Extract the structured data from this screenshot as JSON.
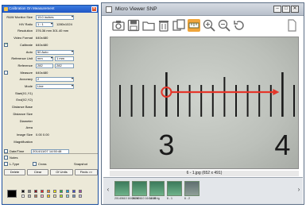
{
  "calibration": {
    "title": "Calibration On Measurement",
    "rows": [
      {
        "label": "R&W Monitor Size",
        "box": "19.0 inches",
        "dd": true
      },
      {
        "label": "H/V Ratio",
        "box": "1 : 1",
        "dd": true,
        "val2": "1280x1024"
      },
      {
        "label": "Resolution",
        "value": "376.36 mm  301.40 mm"
      },
      {
        "label": "Video Format",
        "value": "640x480"
      },
      {
        "label": "Calibrate",
        "value": "640x480",
        "check": true
      },
      {
        "label": "Auto",
        "box": "50 Auto",
        "dd": true
      },
      {
        "label": "Reference Unit",
        "box": "mm",
        "dd": true,
        "box2": "1 mm"
      },
      {
        "label": "Reference",
        "box": "282",
        "box2": "282"
      },
      {
        "label": "Measure",
        "value": "640x480",
        "check": false
      },
      {
        "label": "Accuracy",
        "box": "2",
        "dd": true
      },
      {
        "label": "Mode",
        "box": "Line",
        "dd": true
      },
      {
        "label": "Start(X1,Y1)",
        "value": ""
      },
      {
        "label": "End(X2,Y2)",
        "value": ""
      },
      {
        "label": "Distance Base",
        "value": ""
      },
      {
        "label": "Distance Size",
        "value": ""
      },
      {
        "label": "Diameter",
        "value": ""
      },
      {
        "label": "Area",
        "value": ""
      },
      {
        "label": "Image Size",
        "value": "0.00      0.00"
      },
      {
        "label": "Magnification",
        "value": ""
      }
    ],
    "datetime_label": "Date/Time",
    "datetime_value": "2014/11/07  14:50:48",
    "notes_label": "Notes",
    "l_type_label": "L-Type",
    "cross_label": "Cross",
    "snapshot_label": "Snapshot",
    "buttons": [
      "Delete",
      "Clear",
      "Of Units",
      "Finds >>"
    ]
  },
  "viewer": {
    "title": "Micro Viewer SNP",
    "status": "6 - 1.jpg (652 x 491)",
    "ruler_labels": [
      "3",
      "4"
    ],
    "thumbnails": [
      {
        "label": "20140610 16:04:29"
      },
      {
        "label": "20140610 16:04:29"
      },
      {
        "label": "12:43:tg"
      },
      {
        "label": "6 - 1"
      },
      {
        "label": "6 - 2"
      }
    ],
    "colors": {
      "arrow": "#e5362a",
      "ruler_ink": "#1a1a1a"
    }
  }
}
